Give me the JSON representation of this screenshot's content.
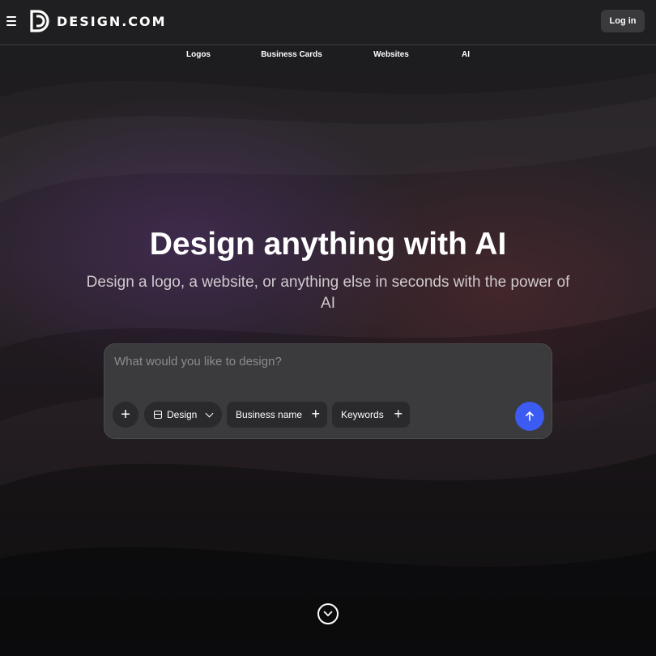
{
  "header": {
    "brand": "DESIGN.COM",
    "login_label": "Log in"
  },
  "nav": {
    "items": [
      {
        "label": "Logos"
      },
      {
        "label": "Business Cards"
      },
      {
        "label": "Websites"
      },
      {
        "label": "AI"
      }
    ]
  },
  "hero": {
    "title": "Design anything with AI",
    "subtitle": "Design a logo, a website, or anything else in seconds with the power of AI"
  },
  "prompt": {
    "placeholder": "What would you like to design?",
    "chips": {
      "design": "Design",
      "business_name": "Business name",
      "keywords": "Keywords"
    }
  },
  "icons": {
    "menu": "hamburger-menu-icon",
    "logo": "design-logo-mark",
    "add": "plus-icon",
    "layout": "layout-icon",
    "chevron": "chevron-down-icon",
    "submit": "arrow-up-icon",
    "scroll": "chevron-down-circle-icon"
  },
  "colors": {
    "accent": "#3b5bf2",
    "header_bg": "#1f1f21",
    "chip_bg": "#2a292c",
    "prompt_bg": "#3b3a3d"
  }
}
